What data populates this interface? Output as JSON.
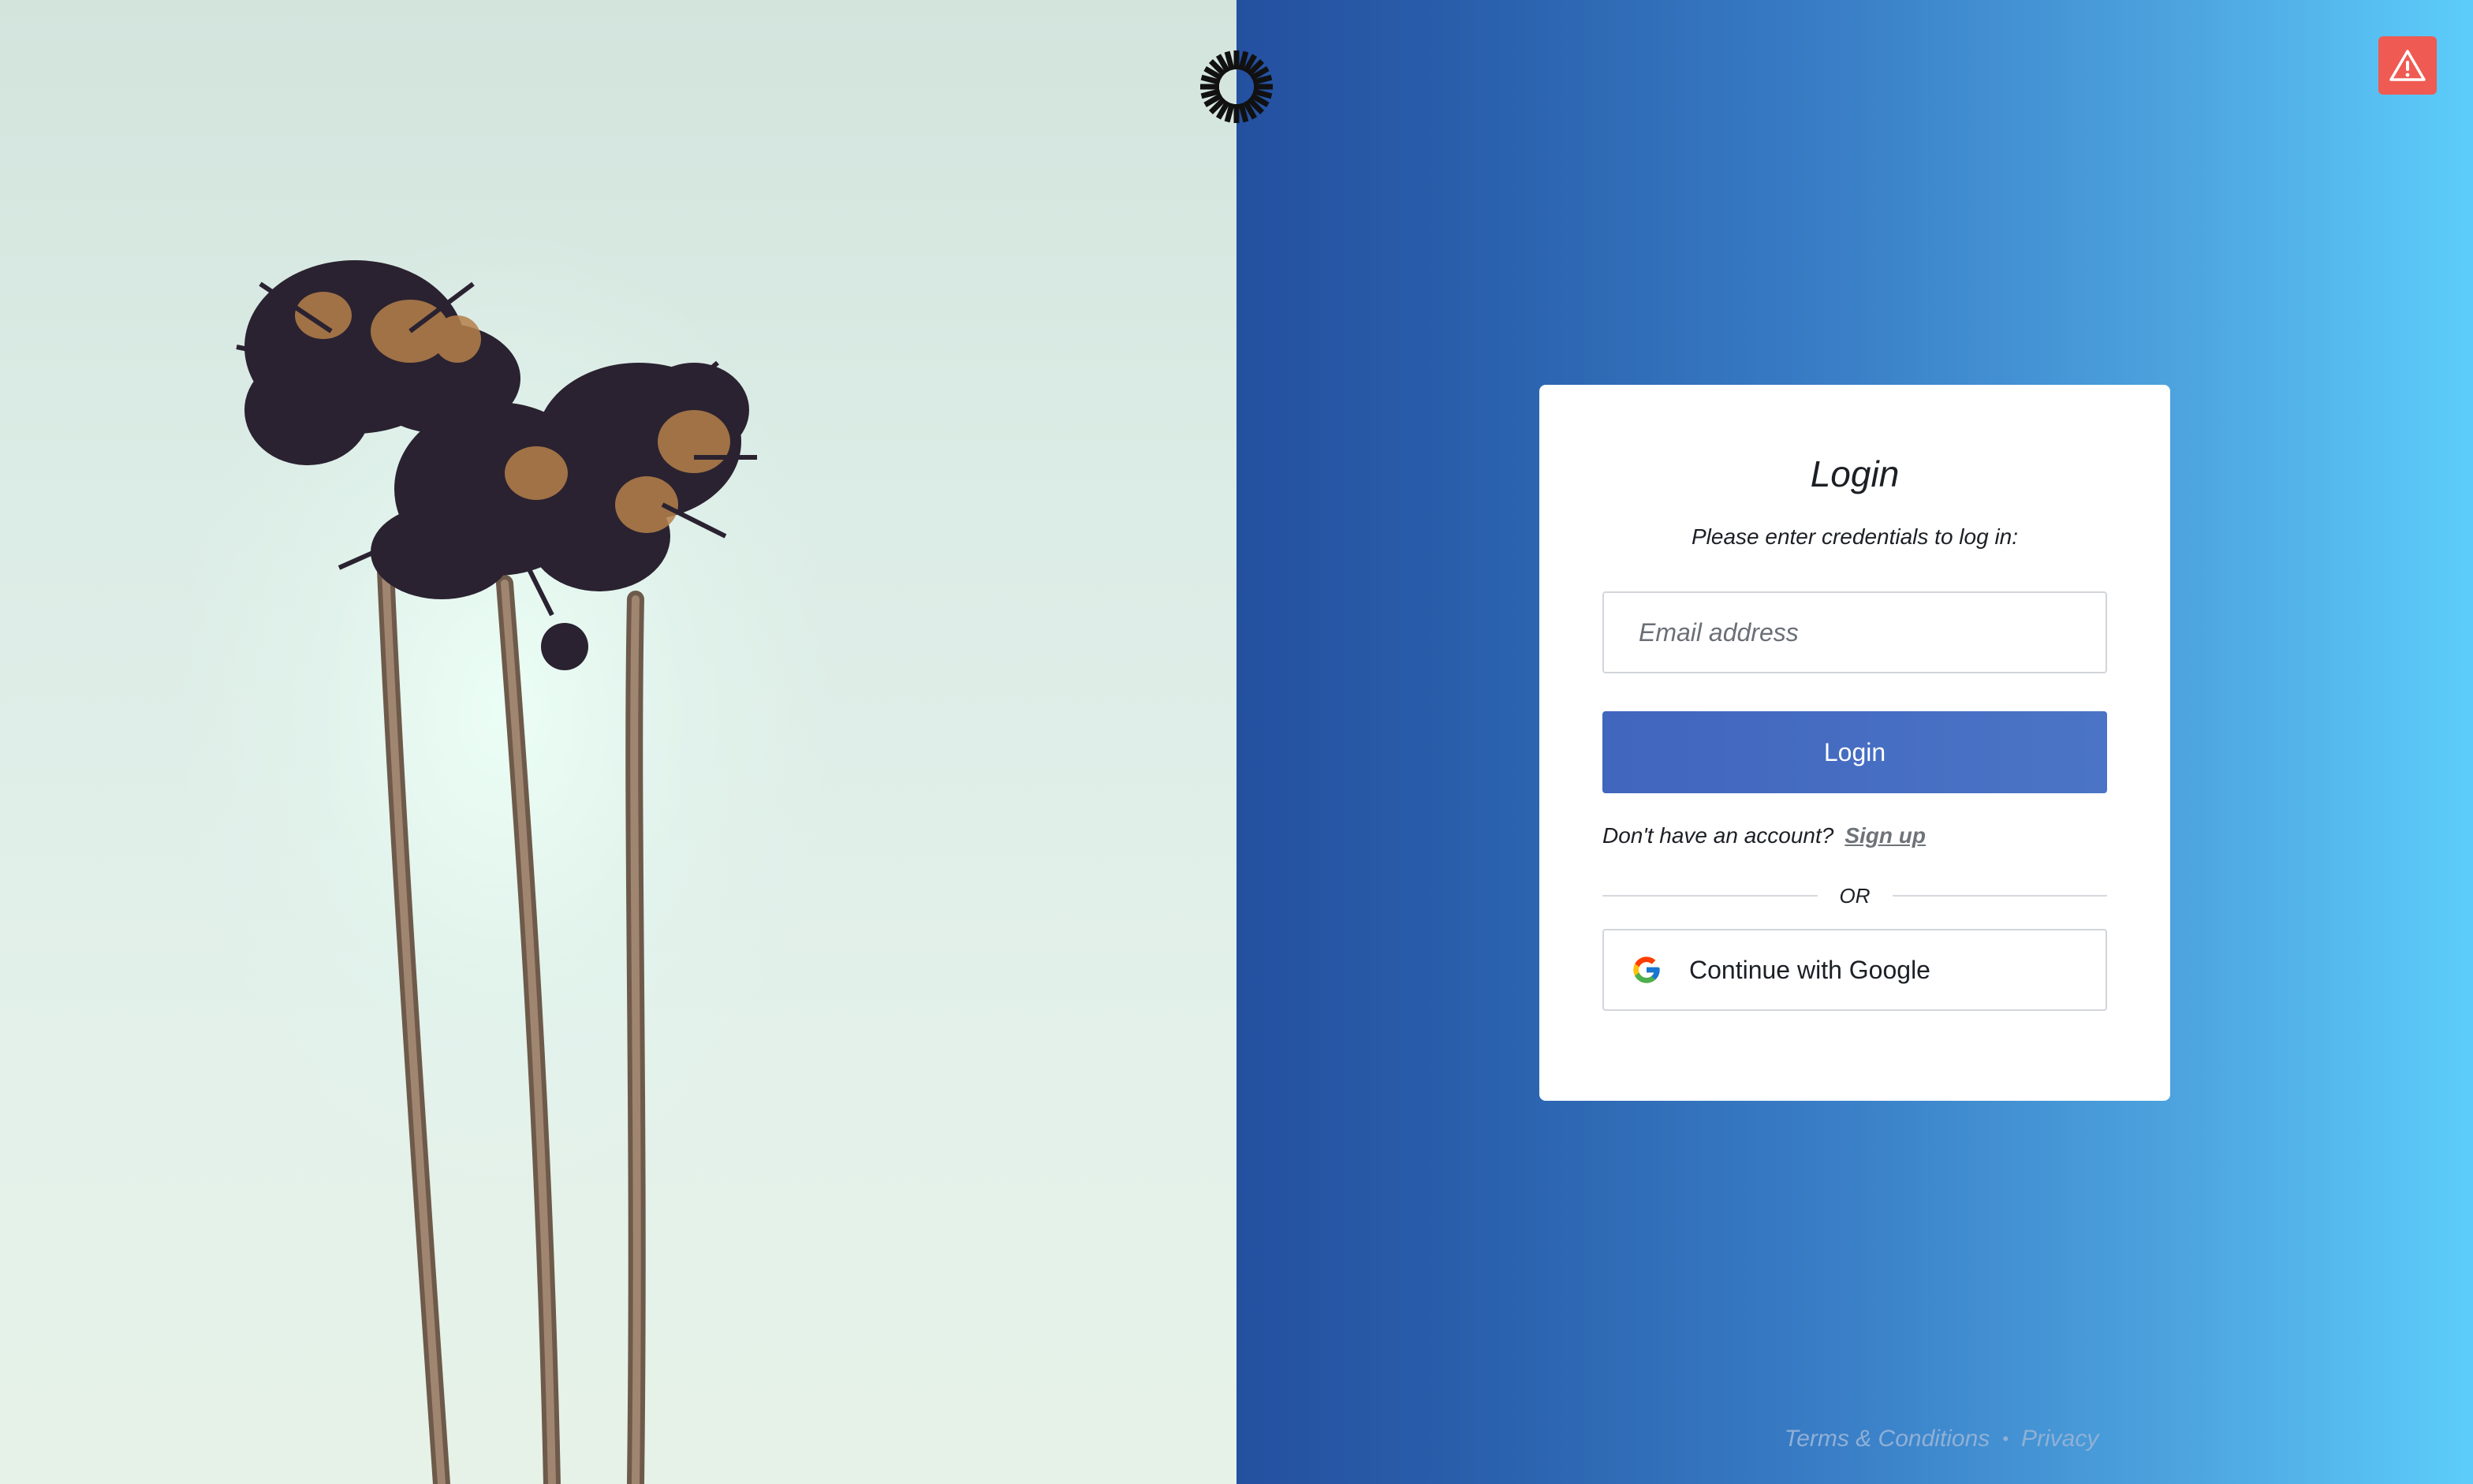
{
  "login_card": {
    "title": "Login",
    "subtitle": "Please enter credentials to log in:",
    "email_placeholder": "Email address",
    "login_button_label": "Login",
    "signup_prompt": "Don't have an account?",
    "signup_link_label": "Sign up",
    "divider_label": "OR",
    "google_button_label": "Continue with Google"
  },
  "footer": {
    "terms_label": "Terms & Conditions",
    "separator": "•",
    "privacy_label": "Privacy"
  },
  "icons": {
    "brand": "sunburst-logo-icon",
    "alert": "warning-triangle-icon",
    "google": "google-g-icon"
  },
  "colors": {
    "gradient_start": "#2450a0",
    "gradient_end": "#5ccdfb",
    "login_button": "#4570c2",
    "alert_button": "#ef5a52"
  }
}
